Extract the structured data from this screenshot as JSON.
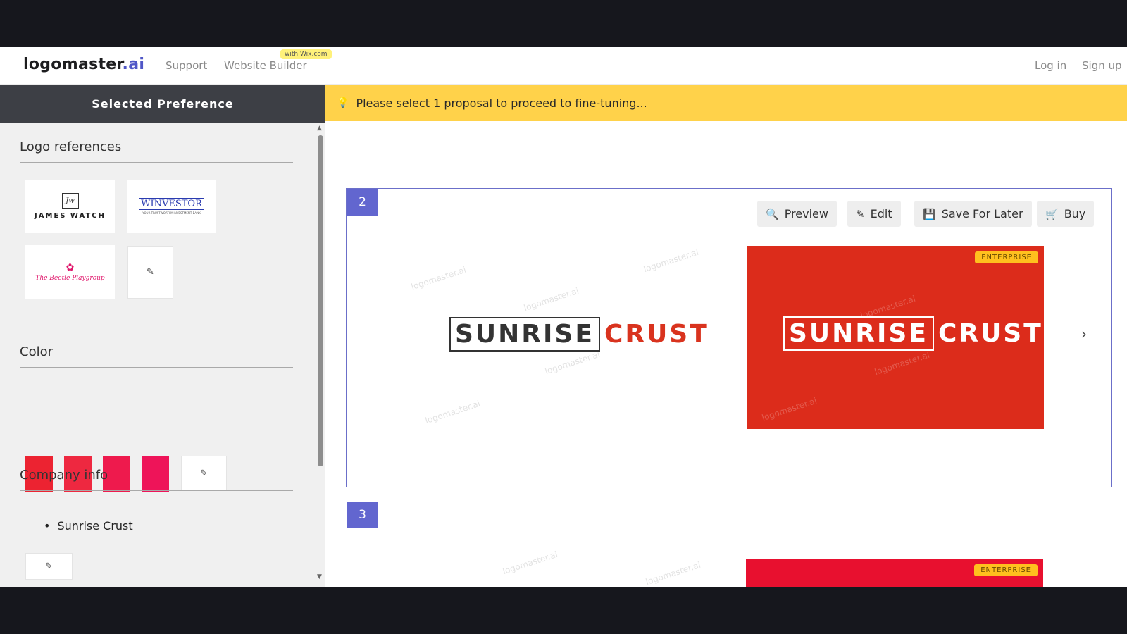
{
  "nav": {
    "logo_main": "logomaster",
    "logo_ai": ".ai",
    "support": "Support",
    "website_builder": "Website Builder",
    "wix_badge": "with Wix.com",
    "login": "Log in",
    "signup": "Sign up"
  },
  "sidebar": {
    "header": "Selected Preference",
    "logo_references_title": "Logo references",
    "references": [
      {
        "label": "JAMES WATCH",
        "monogram": "Jw"
      },
      {
        "label": "WINVESTOR",
        "sub": "YOUR TRUSTWORTHY INVESTMENT BANK"
      },
      {
        "label": "The Beetle Playgroup"
      }
    ],
    "color_title": "Color",
    "colors": [
      "#ec2331",
      "#ee2840",
      "#ee1a4d",
      "#ee1459"
    ],
    "company_title": "Company info",
    "company_items": [
      "Sunrise Crust"
    ]
  },
  "banner": {
    "text": "Please select 1 proposal to proceed to fine-tuning..."
  },
  "proposals": [
    {
      "number": "2",
      "buttons": {
        "preview": "Preview",
        "edit": "Edit",
        "save": "Save For Later",
        "buy": "Buy"
      },
      "logo_word1": "SUNRISE",
      "logo_word2": "CRUST",
      "badge": "ENTERPRISE"
    },
    {
      "number": "3",
      "badge": "ENTERPRISE"
    }
  ],
  "watermark": "logomaster.ai"
}
